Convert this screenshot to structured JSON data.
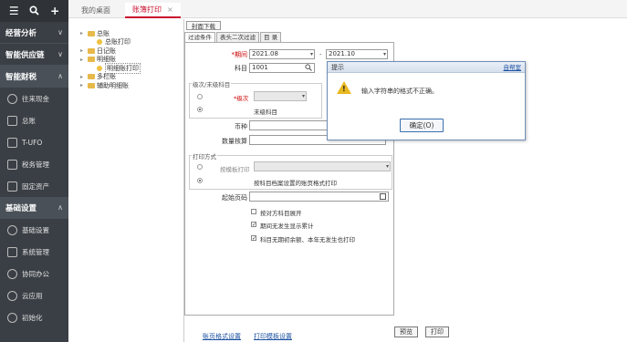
{
  "sidebar": {
    "top_icons": [
      "menu-icon",
      "search-icon",
      "plus-icon"
    ],
    "groups": [
      {
        "label": "经营分析",
        "chevron": "∨"
      },
      {
        "label": "智能供应链",
        "chevron": "∨"
      },
      {
        "label": "智能财税",
        "chevron": "∧"
      },
      {
        "label": "基础设置",
        "chevron": "∧"
      }
    ],
    "finance_items": [
      {
        "label": "往来现金"
      },
      {
        "label": "总账"
      },
      {
        "label": "T-UFO"
      },
      {
        "label": "税务管理"
      },
      {
        "label": "固定资产"
      }
    ],
    "basic_items": [
      {
        "label": "基础设置"
      },
      {
        "label": "系统管理"
      },
      {
        "label": "协同办公"
      },
      {
        "label": "云应用"
      },
      {
        "label": "初始化"
      }
    ]
  },
  "tabs": {
    "desk": "我的桌面",
    "active": "账簿打印",
    "close": "×"
  },
  "tree": [
    {
      "label": "总账",
      "level": 0,
      "type": "folder",
      "toggle": "▸"
    },
    {
      "label": "总账打印",
      "level": 1,
      "type": "doc"
    },
    {
      "label": "日记账",
      "level": 0,
      "type": "folder",
      "toggle": "▸"
    },
    {
      "label": "明细账",
      "level": 0,
      "type": "folder",
      "toggle": "▸"
    },
    {
      "label": "明细账打印",
      "level": 1,
      "type": "doc"
    },
    {
      "label": "多栏账",
      "level": 0,
      "type": "folder",
      "toggle": "▸"
    },
    {
      "label": "辅助明细账",
      "level": 0,
      "type": "folder",
      "toggle": "▸"
    }
  ],
  "form": {
    "cover_button": "封面下载",
    "subtabs": [
      "过滤条件",
      "表头二次过滤",
      "目 录"
    ],
    "period_label": "*期间",
    "period_from": "2021.08",
    "period_sep": "-",
    "period_to": "2021.10",
    "subject_label": "科目",
    "subject_value": "1001",
    "level_group_title": "级次/末级科目",
    "level_label": "*级次",
    "level_tail_label": "末级科目",
    "currency_label": "币种",
    "quantity_label": "数量核算",
    "print_group_title": "打印方式",
    "template_label": "按模板打印",
    "subject_style_label": "按科目档案设置的账页格式打印",
    "start_page_label": "起始页码",
    "checkboxes": [
      {
        "label": "按对方科目展开",
        "checked": false
      },
      {
        "label": "期间无发生显示累计",
        "checked": true
      },
      {
        "label": "科目无期初余额、本年无发生也打印",
        "checked": true
      }
    ],
    "link_page_format": "账页格式设置",
    "link_print_template": "打印模板设置",
    "preview_button": "预览",
    "print_button": "打印"
  },
  "message": {
    "title": "提示",
    "close_link": "自帮室",
    "text": "输入字符串的格式不正确。",
    "ok_button": "确定(O)"
  },
  "icons": {
    "dropdown": "▾",
    "search": "search-icon",
    "warning": "warning-icon",
    "calendar": "calendar-icon"
  }
}
